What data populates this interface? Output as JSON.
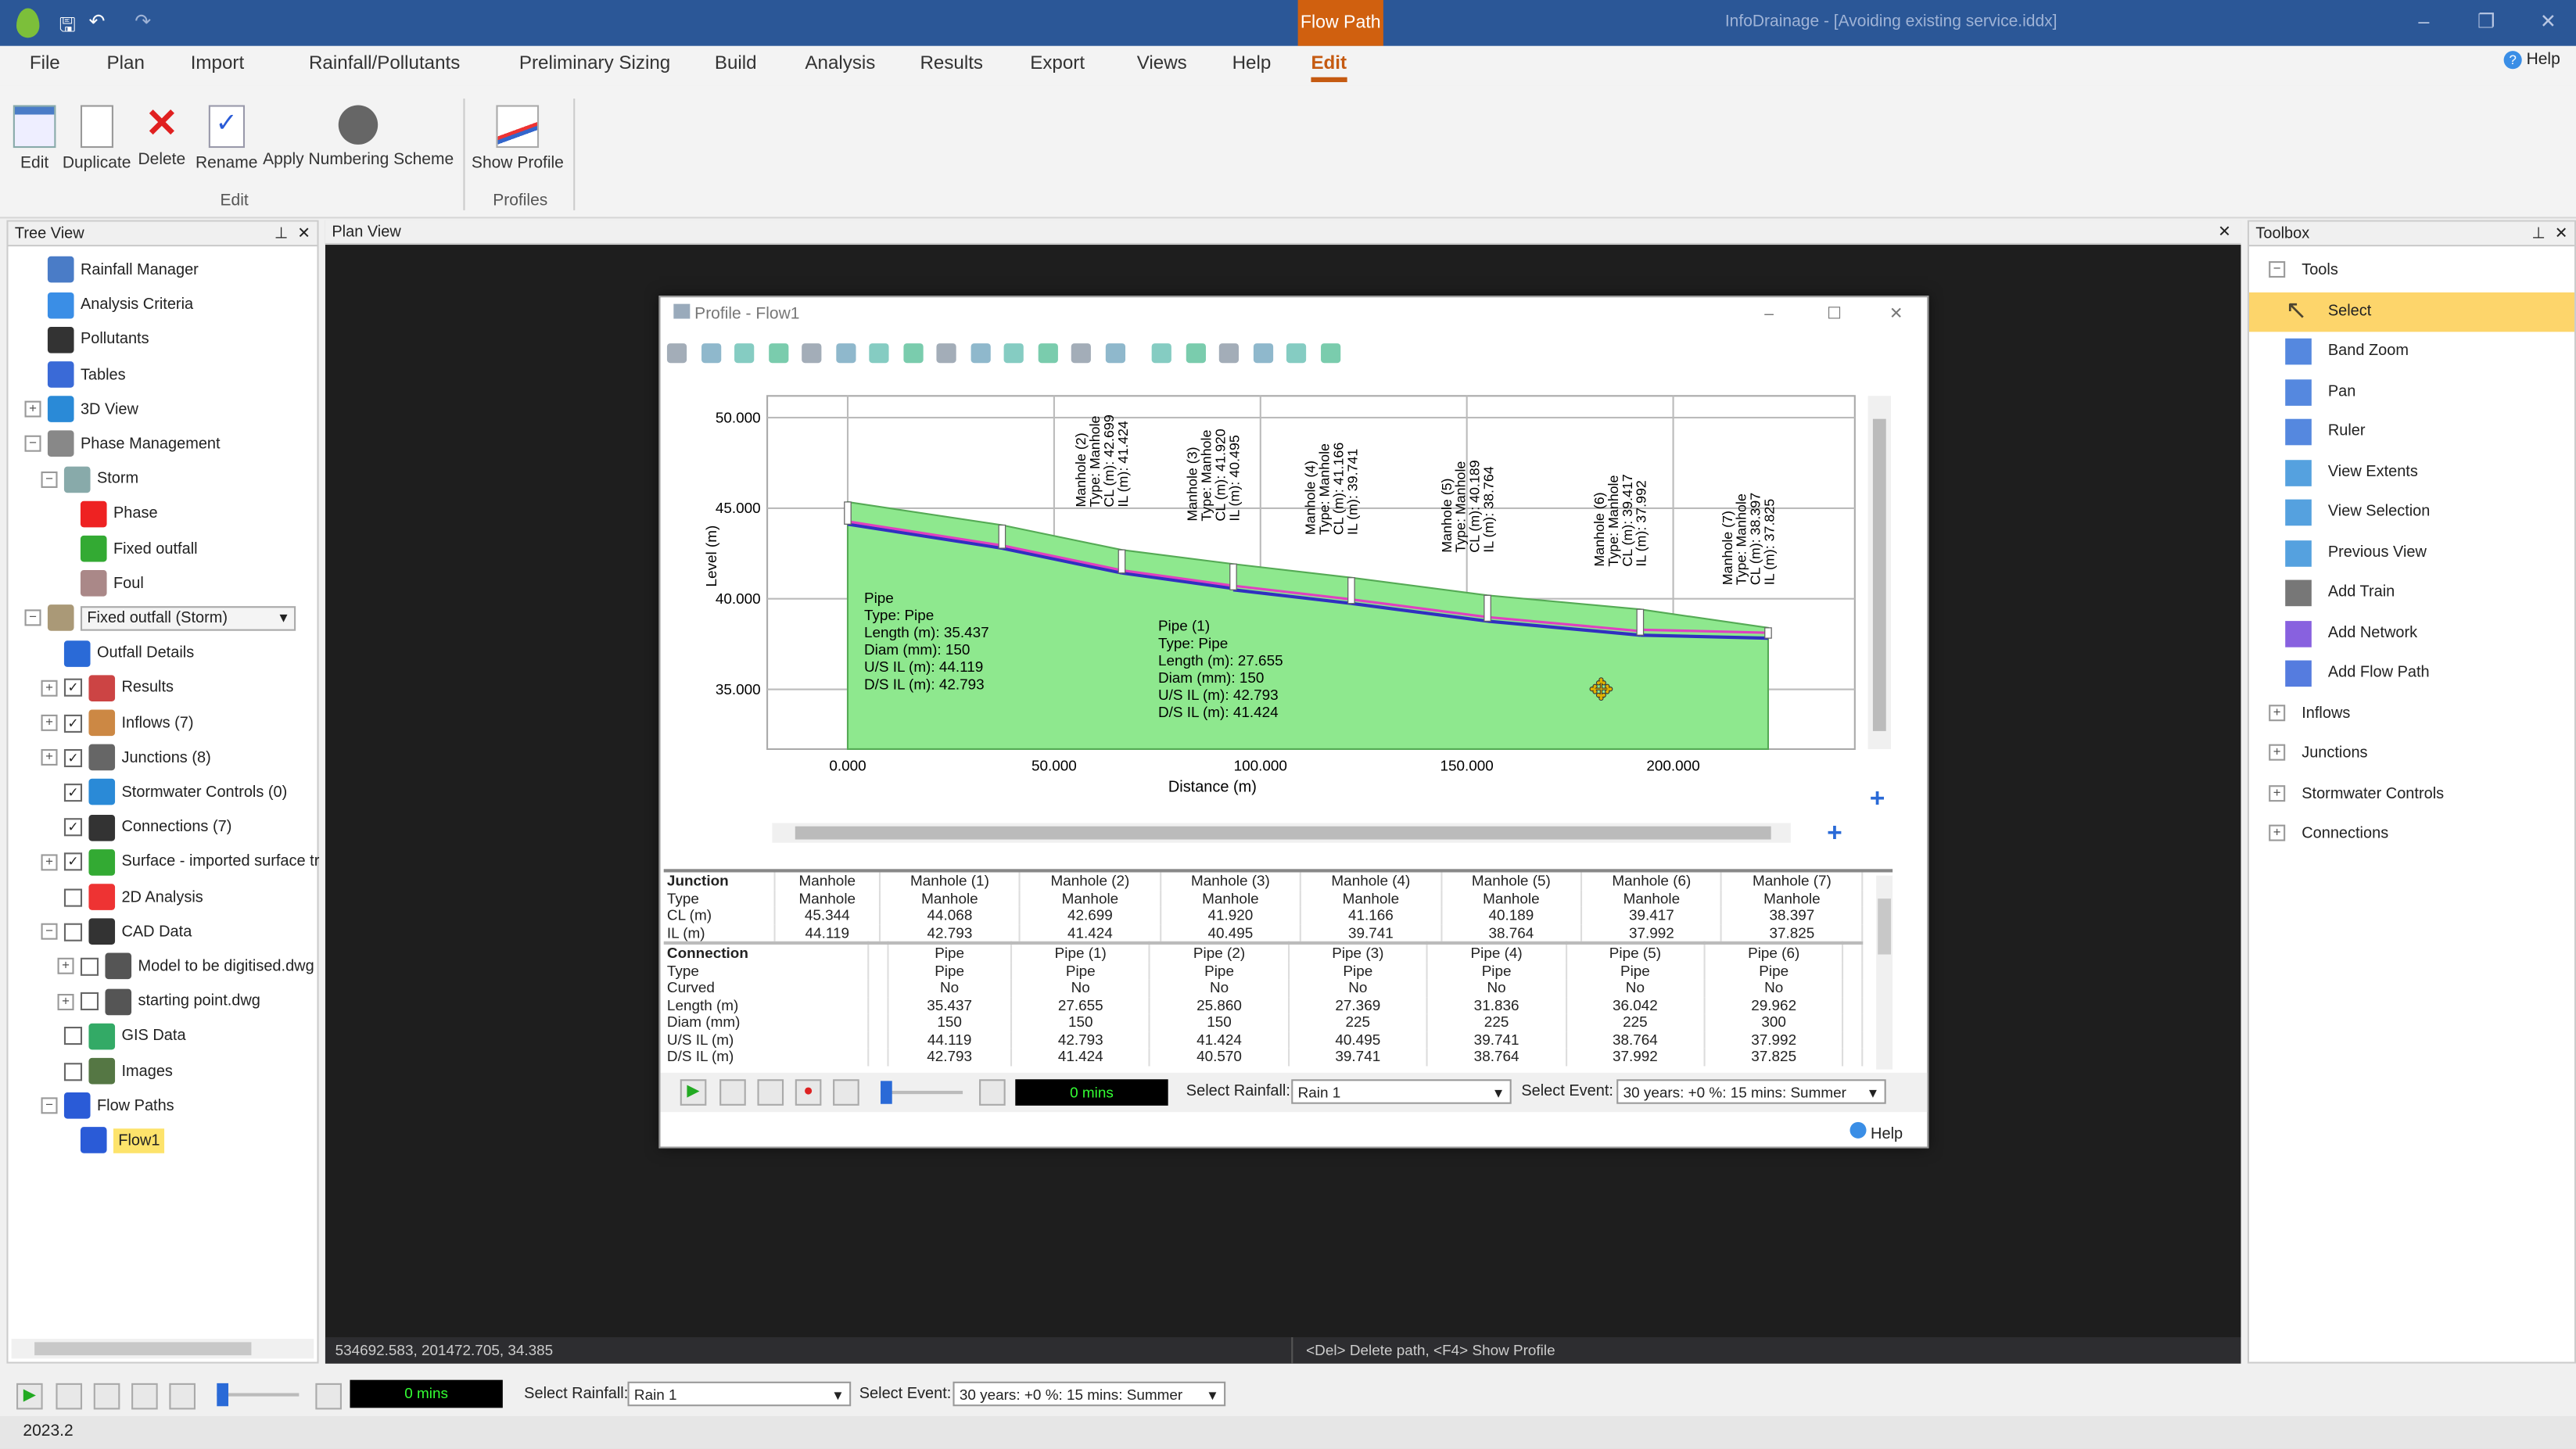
{
  "titlebar": {
    "context_tab": "Flow Path",
    "title": "InfoDrainage - [Avoiding existing service.iddx]",
    "minimize": "–",
    "restore": "❐",
    "close": "✕"
  },
  "menu": [
    "File",
    "Plan",
    "Import",
    "Rainfall/Pollutants",
    "Preliminary Sizing",
    "Build",
    "Analysis",
    "Results",
    "Export",
    "Views",
    "Help",
    "Edit"
  ],
  "menu_active": "Edit",
  "help_link": "Help",
  "ribbon": {
    "groups": [
      {
        "label": "Edit",
        "buttons": [
          "Edit",
          "Duplicate",
          "Delete",
          "Rename",
          "Apply Numbering Scheme"
        ]
      },
      {
        "label": "Profiles",
        "buttons": [
          "Show Profile"
        ]
      }
    ]
  },
  "tree": {
    "title": "Tree View",
    "items": [
      {
        "label": "Rainfall Manager",
        "level": 1,
        "icon": "rainfall-icon"
      },
      {
        "label": "Analysis Criteria",
        "level": 1,
        "icon": "criteria-icon"
      },
      {
        "label": "Pollutants",
        "level": 1,
        "icon": "pollutants-icon"
      },
      {
        "label": "Tables",
        "level": 1,
        "icon": "table-icon"
      },
      {
        "label": "3D View",
        "level": 1,
        "icon": "3d-icon",
        "exp": "+"
      },
      {
        "label": "Phase Management",
        "level": 1,
        "icon": "phase-icon",
        "exp": "−"
      },
      {
        "label": "Storm",
        "level": 2,
        "icon": "storm-icon",
        "exp": "−"
      },
      {
        "label": "Phase",
        "level": 3,
        "icon": "stop-icon"
      },
      {
        "label": "Fixed outfall",
        "level": 3,
        "icon": "go-icon"
      },
      {
        "label": "Foul",
        "level": 3,
        "icon": "foul-icon"
      },
      {
        "label": "Fixed outfall (Storm)",
        "level": 1,
        "icon": "phase-icon",
        "exp": "−",
        "dropdown": true
      },
      {
        "label": "Outfall Details",
        "level": 2,
        "icon": "outfall-icon"
      },
      {
        "label": "Results",
        "level": 2,
        "icon": "results-icon",
        "exp": "+",
        "check": true
      },
      {
        "label": "Inflows (7)",
        "level": 2,
        "icon": "inflow-icon",
        "exp": "+",
        "check": true
      },
      {
        "label": "Junctions (8)",
        "level": 2,
        "icon": "junction-icon",
        "exp": "+",
        "check": true
      },
      {
        "label": "Stormwater Controls (0)",
        "level": 2,
        "icon": "control-icon",
        "check": true
      },
      {
        "label": "Connections (7)",
        "level": 2,
        "icon": "connection-icon",
        "check": true
      },
      {
        "label": "Surface - imported surface tr",
        "level": 2,
        "icon": "surface-icon",
        "exp": "+",
        "check": true
      },
      {
        "label": "2D Analysis",
        "level": 2,
        "icon": "2d-icon",
        "check": false
      },
      {
        "label": "CAD Data",
        "level": 2,
        "icon": "cad-icon",
        "exp": "−",
        "check": false
      },
      {
        "label": "Model to be digitised.dwg",
        "level": 3,
        "icon": "dwg-icon",
        "exp": "+",
        "check": false
      },
      {
        "label": "starting point.dwg",
        "level": 3,
        "icon": "dwg-icon",
        "exp": "+",
        "check": false
      },
      {
        "label": "GIS Data",
        "level": 2,
        "icon": "gis-icon",
        "check": false
      },
      {
        "label": "Images",
        "level": 2,
        "icon": "image-icon",
        "check": false
      },
      {
        "label": "Flow Paths",
        "level": 2,
        "icon": "flowpath-icon",
        "exp": "−"
      },
      {
        "label": "Flow1",
        "level": 3,
        "icon": "flowpath-icon",
        "selected": true
      }
    ]
  },
  "plan": {
    "title": "Plan View",
    "coords": "534692.583, 201472.705, 34.385",
    "hint": "<Del> Delete path, <F4> Show Profile"
  },
  "toolbox": {
    "title": "Toolbox",
    "sections": [
      {
        "label": "Tools",
        "exp": "−",
        "items": [
          "Select",
          "Band Zoom",
          "Pan",
          "Ruler",
          "View Extents",
          "View Selection",
          "Previous View",
          "Add Train",
          "Add Network",
          "Add Flow Path"
        ],
        "selected": "Select"
      },
      {
        "label": "Inflows",
        "exp": "+"
      },
      {
        "label": "Junctions",
        "exp": "+"
      },
      {
        "label": "Stormwater Controls",
        "exp": "+"
      },
      {
        "label": "Connections",
        "exp": "+"
      }
    ]
  },
  "profile": {
    "title": "Profile - Flow1",
    "help": "Help",
    "controls": {
      "time": "0 mins",
      "rainfall_label": "Select Rainfall:",
      "rainfall": "Rain 1",
      "event_label": "Select Event:",
      "event": "30 years: +0 %: 15 mins: Summer"
    },
    "junction_rows": {
      "header": "Junction",
      "labels": [
        "Type",
        "CL (m)",
        "IL (m)"
      ]
    },
    "connection_rows": {
      "header": "Connection",
      "labels": [
        "Type",
        "Curved",
        "Length (m)",
        "Diam (mm)",
        "U/S IL (m)",
        "D/S IL (m)"
      ]
    }
  },
  "chart_data": {
    "type": "line",
    "xlabel": "Distance (m)",
    "ylabel": "Level (m)",
    "xlim": [
      -19.5,
      244
    ],
    "ylim": [
      31.7,
      51.2
    ],
    "xticks": [
      "0.000",
      "50.000",
      "100.000",
      "150.000",
      "200.000"
    ],
    "yticks": [
      "50.000",
      "45.000",
      "40.000",
      "35.000"
    ],
    "grid": true,
    "colors": {
      "ground": "#8ee88e",
      "pipe_invert": "#3030c0",
      "pipe_crown": "#e040c0"
    },
    "junctions": [
      {
        "name": "Manhole",
        "type": "Manhole",
        "chainage": 0,
        "cl": 45.344,
        "il": 44.119
      },
      {
        "name": "Manhole (1)",
        "type": "Manhole",
        "chainage": 37.4,
        "cl": 44.068,
        "il": 42.793
      },
      {
        "name": "Manhole (2)",
        "type": "Manhole",
        "chainage": 66.4,
        "cl": 42.699,
        "il": 41.424
      },
      {
        "name": "Manhole (3)",
        "type": "Manhole",
        "chainage": 93.4,
        "cl": 41.92,
        "il": 40.495
      },
      {
        "name": "Manhole (4)",
        "type": "Manhole",
        "chainage": 122,
        "cl": 41.166,
        "il": 39.741
      },
      {
        "name": "Manhole (5)",
        "type": "Manhole",
        "chainage": 155,
        "cl": 40.189,
        "il": 38.764
      },
      {
        "name": "Manhole (6)",
        "type": "Manhole",
        "chainage": 192,
        "cl": 39.417,
        "il": 37.992
      },
      {
        "name": "Manhole (7)",
        "type": "Manhole",
        "chainage": 223,
        "cl": 38.397,
        "il": 37.825
      }
    ],
    "connections": [
      {
        "name": "Pipe",
        "type": "Pipe",
        "curved": "No",
        "length": "35.437",
        "diam": "150",
        "us_il": "44.119",
        "ds_il": "42.793"
      },
      {
        "name": "Pipe (1)",
        "type": "Pipe",
        "curved": "No",
        "length": "27.655",
        "diam": "150",
        "us_il": "42.793",
        "ds_il": "41.424"
      },
      {
        "name": "Pipe (2)",
        "type": "Pipe",
        "curved": "No",
        "length": "25.860",
        "diam": "150",
        "us_il": "41.424",
        "ds_il": "40.570"
      },
      {
        "name": "Pipe (3)",
        "type": "Pipe",
        "curved": "No",
        "length": "27.369",
        "diam": "225",
        "us_il": "40.495",
        "ds_il": "39.741"
      },
      {
        "name": "Pipe (4)",
        "type": "Pipe",
        "curved": "No",
        "length": "31.836",
        "diam": "225",
        "us_il": "39.741",
        "ds_il": "38.764"
      },
      {
        "name": "Pipe (5)",
        "type": "Pipe",
        "curved": "No",
        "length": "36.042",
        "diam": "225",
        "us_il": "38.764",
        "ds_il": "37.992"
      },
      {
        "name": "Pipe (6)",
        "type": "Pipe",
        "curved": "No",
        "length": "29.962",
        "diam": "300",
        "us_il": "37.992",
        "ds_il": "37.825"
      }
    ],
    "junction_labels_shown": [
      "Manhole (2)",
      "Manhole (3)",
      "Manhole (4)",
      "Manhole (5)",
      "Manhole (6)",
      "Manhole (7)"
    ],
    "pipe_labels_shown": [
      "Pipe",
      "Pipe (1)"
    ]
  },
  "bottom": {
    "time": "0 mins",
    "rainfall_label": "Select Rainfall:",
    "rainfall": "Rain 1",
    "event_label": "Select Event:",
    "event": "30 years: +0 %: 15 mins: Summer"
  },
  "version": "2023.2"
}
